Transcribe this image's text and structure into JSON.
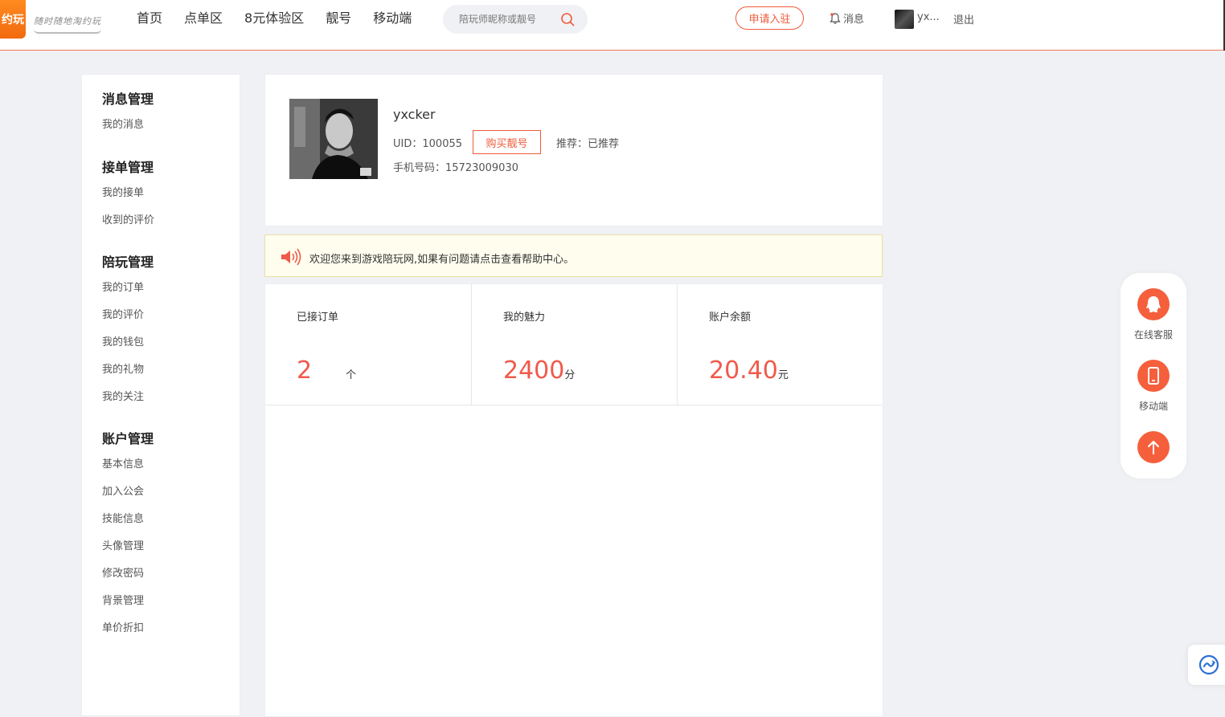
{
  "header": {
    "logo_text": "约玩",
    "slogan": "随时随地淘约玩",
    "nav": [
      "首页",
      "点单区",
      "8元体验区",
      "靓号",
      "移动端"
    ],
    "search_placeholder": "陪玩师昵称或靓号",
    "apply_label": "申请入驻",
    "message_label": "消息",
    "username_short": "yx...",
    "logout_label": "退出"
  },
  "sidebar": {
    "groups": [
      {
        "title": "消息管理",
        "items": [
          "我的消息"
        ]
      },
      {
        "title": "接单管理",
        "items": [
          "我的接单",
          "收到的评价"
        ]
      },
      {
        "title": "陪玩管理",
        "items": [
          "我的订单",
          "我的评价",
          "我的钱包",
          "我的礼物",
          "我的关注"
        ]
      },
      {
        "title": "账户管理",
        "items": [
          "基本信息",
          "加入公会",
          "技能信息",
          "头像管理",
          "修改密码",
          "背景管理",
          "单价折扣"
        ]
      }
    ]
  },
  "profile": {
    "username": "yxcker",
    "uid_label": "UID：",
    "uid": "100055",
    "buy_label": "购买靓号",
    "recommend_label": "推荐：",
    "recommend_value": "已推荐",
    "phone_label": "手机号码：",
    "phone": "15723009030"
  },
  "notice": {
    "text": "欢迎您来到游戏陪玩网,如果有问题请点击查看帮助中心。"
  },
  "stats": [
    {
      "label": "已接订单",
      "value": "2",
      "unit": "个"
    },
    {
      "label": "我的魅力",
      "value": "2400",
      "unit": "分"
    },
    {
      "label": "账户余额",
      "value": "20.40",
      "unit": "元"
    }
  ],
  "float_bar": {
    "service_label": "在线客服",
    "mobile_label": "移动端"
  },
  "colors": {
    "accent": "#ef5b3b",
    "stat_value": "#f05a4b",
    "notice_bg": "#fffeee",
    "page_bg": "#f0f1f4"
  },
  "icons": [
    "search-icon",
    "bell-icon",
    "speaker-icon",
    "qq-icon",
    "phone-icon",
    "arrow-up-icon",
    "translate-icon"
  ]
}
